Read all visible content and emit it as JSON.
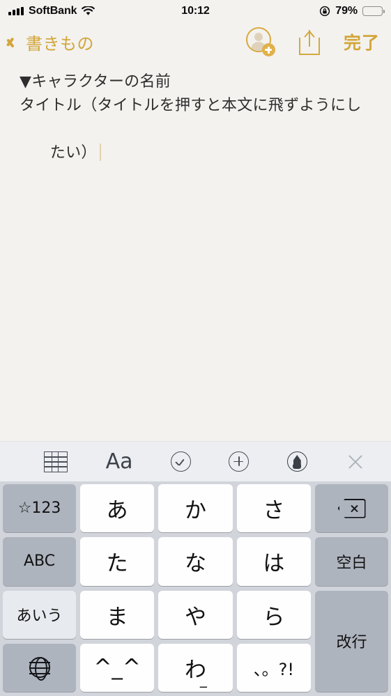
{
  "status_bar": {
    "carrier": "SoftBank",
    "signal_bars": 4,
    "wifi_icon": "wifi-icon",
    "time": "10:12",
    "rotation_lock_icon": "rotation-lock-icon",
    "battery_percent": "79%",
    "battery_level": 79,
    "battery_color": "#f5c44a"
  },
  "nav_bar": {
    "back_label": "書きもの",
    "back_icon": "chevron-left-icon",
    "add_person_icon": "add-person-icon",
    "share_icon": "share-icon",
    "done_label": "完了",
    "accent_color": "#d3a63a"
  },
  "note": {
    "line1": "▼キャラクターの名前",
    "line2": "タイトル（タイトルを押すと本文に飛ずようにし",
    "line3": "たい）",
    "full_text": "▼キャラクターの名前\nタイトル（タイトルを押すと本文に飛ずようにしたい）",
    "caret_color": "#e2d3ab",
    "background_color": "#f4f3f0"
  },
  "format_toolbar": {
    "background_color": "#eceef1",
    "items": [
      {
        "name": "table-icon",
        "label": ""
      },
      {
        "name": "text-format-icon",
        "label": "Aa"
      },
      {
        "name": "checklist-icon",
        "label": ""
      },
      {
        "name": "add-attachment-icon",
        "label": ""
      },
      {
        "name": "markup-pen-icon",
        "label": ""
      }
    ],
    "close_icon": "close-icon"
  },
  "keyboard": {
    "background_color": "#d1d5db",
    "white_key_color": "#fefefe",
    "grey_key_color": "#aeb4be",
    "active_key_color": "#e7eaee",
    "rows": [
      [
        {
          "name": "key-numbers",
          "label": "☆123",
          "style": "grey"
        },
        {
          "name": "key-a",
          "label": "あ",
          "style": "white"
        },
        {
          "name": "key-ka",
          "label": "か",
          "style": "white"
        },
        {
          "name": "key-sa",
          "label": "さ",
          "style": "white"
        },
        {
          "name": "key-backspace",
          "label": "",
          "style": "grey",
          "icon": "backspace-icon"
        }
      ],
      [
        {
          "name": "key-abc",
          "label": "ABC",
          "style": "grey"
        },
        {
          "name": "key-ta",
          "label": "た",
          "style": "white"
        },
        {
          "name": "key-na",
          "label": "な",
          "style": "white"
        },
        {
          "name": "key-ha",
          "label": "は",
          "style": "white"
        },
        {
          "name": "key-space",
          "label": "空白",
          "style": "grey"
        }
      ],
      [
        {
          "name": "key-aiu",
          "label": "あいう",
          "style": "light"
        },
        {
          "name": "key-ma",
          "label": "ま",
          "style": "white"
        },
        {
          "name": "key-ya",
          "label": "や",
          "style": "white"
        },
        {
          "name": "key-ra",
          "label": "ら",
          "style": "white"
        },
        {
          "name": "key-return",
          "label": "改行",
          "style": "grey"
        }
      ],
      [
        {
          "name": "key-globe",
          "label": "",
          "style": "grey",
          "icon": "globe-icon"
        },
        {
          "name": "key-emoticon",
          "label": "^_^",
          "style": "white"
        },
        {
          "name": "key-wa",
          "label": "わ",
          "style": "white",
          "sub": "_"
        },
        {
          "name": "key-punctuation",
          "label": "、。?!",
          "style": "white"
        }
      ]
    ]
  }
}
